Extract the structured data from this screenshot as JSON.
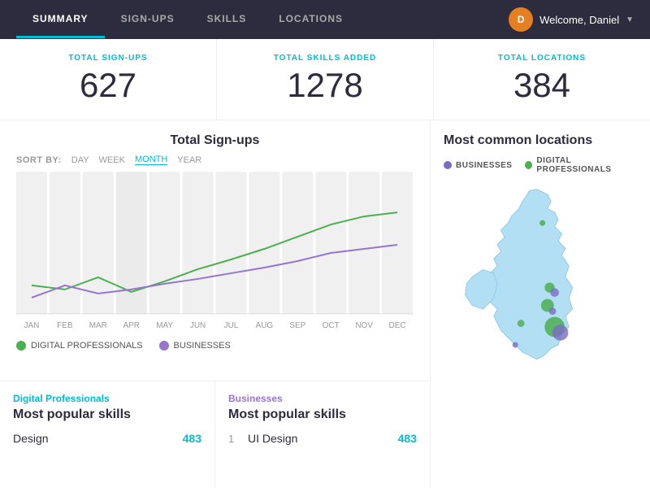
{
  "nav": {
    "tabs": [
      {
        "label": "SUMMARY",
        "active": true
      },
      {
        "label": "SIGN-UPS",
        "active": false
      },
      {
        "label": "SKILLS",
        "active": false
      },
      {
        "label": "LOCATIONS",
        "active": false
      }
    ],
    "user_greeting": "Welcome, Daniel"
  },
  "stats": {
    "signup": {
      "label": "TOTAL SIGN-UPS",
      "value": "627"
    },
    "skills": {
      "label": "TOTAL SKILLS ADDED",
      "value": "1278"
    },
    "locations": {
      "label": "TOTAL LOCATIONS",
      "value": "384"
    }
  },
  "chart": {
    "title": "Total Sign-ups",
    "sort_label": "SORT BY:",
    "sort_options": [
      "DAY",
      "WEEK",
      "MONTH",
      "YEAR"
    ],
    "sort_active": "MONTH",
    "x_labels": [
      "JAN",
      "FEB",
      "MAR",
      "APR",
      "MAY",
      "JUN",
      "JUL",
      "AUG",
      "SEP",
      "OCT",
      "NOV",
      "DEC"
    ],
    "legend": [
      {
        "label": "DIGITAL PROFESSIONALS",
        "color": "#4caf50"
      },
      {
        "label": "BUSINESSES",
        "color": "#9575cd"
      }
    ]
  },
  "skills": {
    "digital_professionals": {
      "category": "Digital Professionals",
      "heading": "Most popular skills",
      "items": [
        {
          "rank": "",
          "name": "Design",
          "count": "483"
        }
      ]
    },
    "businesses": {
      "category": "Businesses",
      "heading": "Most popular skills",
      "items": [
        {
          "rank": "1",
          "name": "UI Design",
          "count": "483"
        }
      ]
    }
  },
  "map": {
    "title": "Most common locations",
    "legend": [
      {
        "label": "BUSINESSES",
        "color": "#7c6bc4"
      },
      {
        "label": "DIGITAL PROFESSIONALS",
        "color": "#4caf50"
      }
    ]
  }
}
